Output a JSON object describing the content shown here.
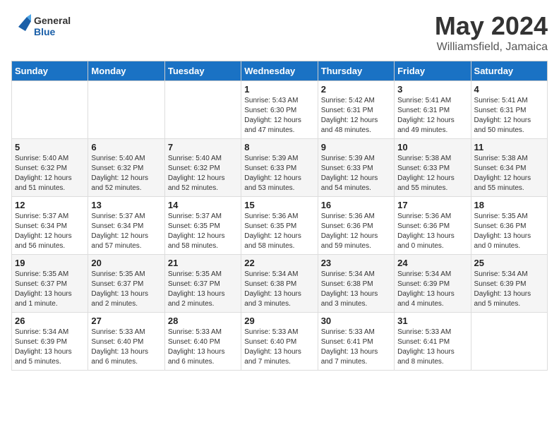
{
  "header": {
    "logo_general": "General",
    "logo_blue": "Blue",
    "month": "May 2024",
    "location": "Williamsfield, Jamaica"
  },
  "days_of_week": [
    "Sunday",
    "Monday",
    "Tuesday",
    "Wednesday",
    "Thursday",
    "Friday",
    "Saturday"
  ],
  "weeks": [
    [
      {
        "day": "",
        "info": ""
      },
      {
        "day": "",
        "info": ""
      },
      {
        "day": "",
        "info": ""
      },
      {
        "day": "1",
        "info": "Sunrise: 5:43 AM\nSunset: 6:30 PM\nDaylight: 12 hours\nand 47 minutes."
      },
      {
        "day": "2",
        "info": "Sunrise: 5:42 AM\nSunset: 6:31 PM\nDaylight: 12 hours\nand 48 minutes."
      },
      {
        "day": "3",
        "info": "Sunrise: 5:41 AM\nSunset: 6:31 PM\nDaylight: 12 hours\nand 49 minutes."
      },
      {
        "day": "4",
        "info": "Sunrise: 5:41 AM\nSunset: 6:31 PM\nDaylight: 12 hours\nand 50 minutes."
      }
    ],
    [
      {
        "day": "5",
        "info": "Sunrise: 5:40 AM\nSunset: 6:32 PM\nDaylight: 12 hours\nand 51 minutes."
      },
      {
        "day": "6",
        "info": "Sunrise: 5:40 AM\nSunset: 6:32 PM\nDaylight: 12 hours\nand 52 minutes."
      },
      {
        "day": "7",
        "info": "Sunrise: 5:40 AM\nSunset: 6:32 PM\nDaylight: 12 hours\nand 52 minutes."
      },
      {
        "day": "8",
        "info": "Sunrise: 5:39 AM\nSunset: 6:33 PM\nDaylight: 12 hours\nand 53 minutes."
      },
      {
        "day": "9",
        "info": "Sunrise: 5:39 AM\nSunset: 6:33 PM\nDaylight: 12 hours\nand 54 minutes."
      },
      {
        "day": "10",
        "info": "Sunrise: 5:38 AM\nSunset: 6:33 PM\nDaylight: 12 hours\nand 55 minutes."
      },
      {
        "day": "11",
        "info": "Sunrise: 5:38 AM\nSunset: 6:34 PM\nDaylight: 12 hours\nand 55 minutes."
      }
    ],
    [
      {
        "day": "12",
        "info": "Sunrise: 5:37 AM\nSunset: 6:34 PM\nDaylight: 12 hours\nand 56 minutes."
      },
      {
        "day": "13",
        "info": "Sunrise: 5:37 AM\nSunset: 6:34 PM\nDaylight: 12 hours\nand 57 minutes."
      },
      {
        "day": "14",
        "info": "Sunrise: 5:37 AM\nSunset: 6:35 PM\nDaylight: 12 hours\nand 58 minutes."
      },
      {
        "day": "15",
        "info": "Sunrise: 5:36 AM\nSunset: 6:35 PM\nDaylight: 12 hours\nand 58 minutes."
      },
      {
        "day": "16",
        "info": "Sunrise: 5:36 AM\nSunset: 6:36 PM\nDaylight: 12 hours\nand 59 minutes."
      },
      {
        "day": "17",
        "info": "Sunrise: 5:36 AM\nSunset: 6:36 PM\nDaylight: 13 hours\nand 0 minutes."
      },
      {
        "day": "18",
        "info": "Sunrise: 5:35 AM\nSunset: 6:36 PM\nDaylight: 13 hours\nand 0 minutes."
      }
    ],
    [
      {
        "day": "19",
        "info": "Sunrise: 5:35 AM\nSunset: 6:37 PM\nDaylight: 13 hours\nand 1 minute."
      },
      {
        "day": "20",
        "info": "Sunrise: 5:35 AM\nSunset: 6:37 PM\nDaylight: 13 hours\nand 2 minutes."
      },
      {
        "day": "21",
        "info": "Sunrise: 5:35 AM\nSunset: 6:37 PM\nDaylight: 13 hours\nand 2 minutes."
      },
      {
        "day": "22",
        "info": "Sunrise: 5:34 AM\nSunset: 6:38 PM\nDaylight: 13 hours\nand 3 minutes."
      },
      {
        "day": "23",
        "info": "Sunrise: 5:34 AM\nSunset: 6:38 PM\nDaylight: 13 hours\nand 3 minutes."
      },
      {
        "day": "24",
        "info": "Sunrise: 5:34 AM\nSunset: 6:39 PM\nDaylight: 13 hours\nand 4 minutes."
      },
      {
        "day": "25",
        "info": "Sunrise: 5:34 AM\nSunset: 6:39 PM\nDaylight: 13 hours\nand 5 minutes."
      }
    ],
    [
      {
        "day": "26",
        "info": "Sunrise: 5:34 AM\nSunset: 6:39 PM\nDaylight: 13 hours\nand 5 minutes."
      },
      {
        "day": "27",
        "info": "Sunrise: 5:33 AM\nSunset: 6:40 PM\nDaylight: 13 hours\nand 6 minutes."
      },
      {
        "day": "28",
        "info": "Sunrise: 5:33 AM\nSunset: 6:40 PM\nDaylight: 13 hours\nand 6 minutes."
      },
      {
        "day": "29",
        "info": "Sunrise: 5:33 AM\nSunset: 6:40 PM\nDaylight: 13 hours\nand 7 minutes."
      },
      {
        "day": "30",
        "info": "Sunrise: 5:33 AM\nSunset: 6:41 PM\nDaylight: 13 hours\nand 7 minutes."
      },
      {
        "day": "31",
        "info": "Sunrise: 5:33 AM\nSunset: 6:41 PM\nDaylight: 13 hours\nand 8 minutes."
      },
      {
        "day": "",
        "info": ""
      }
    ]
  ]
}
